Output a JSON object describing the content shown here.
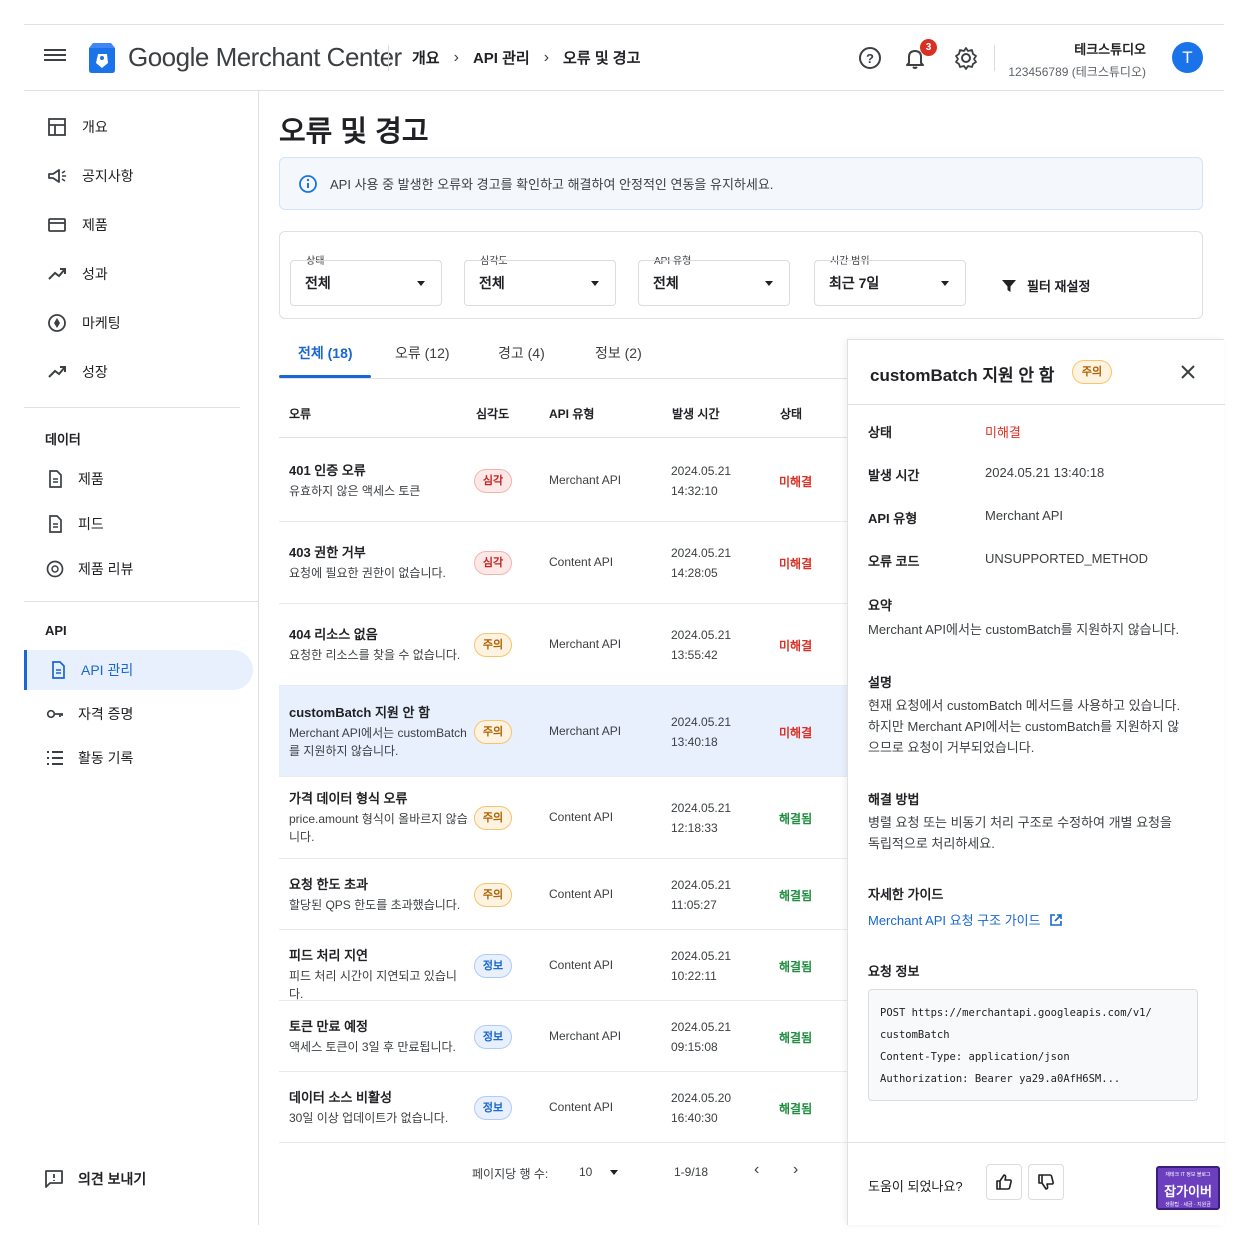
{
  "app": {
    "brand_google": "Google",
    "brand_product": " Merchant Center",
    "breadcrumbs": [
      "개요",
      "API 관리",
      "오류 및 경고"
    ],
    "notification_count": "3",
    "account_name": "테크스튜디오",
    "account_id": "123456789 (테크스튜디오)",
    "avatar_initial": "T"
  },
  "sidebar": {
    "items": [
      {
        "label": "개요",
        "icon": "dashboard-icon"
      },
      {
        "label": "공지사항",
        "icon": "megaphone-icon"
      },
      {
        "label": "제품",
        "icon": "store-icon"
      },
      {
        "label": "성과",
        "icon": "trending-icon"
      },
      {
        "label": "마케팅",
        "icon": "marketing-icon"
      },
      {
        "label": "성장",
        "icon": "growth-icon"
      }
    ],
    "data_header": "데이터",
    "data_items": [
      {
        "label": "제품",
        "icon": "document-icon"
      },
      {
        "label": "피드",
        "icon": "document-icon"
      },
      {
        "label": "제품 리뷰",
        "icon": "review-icon"
      }
    ],
    "api_header": "API",
    "api_items": [
      {
        "label": "API 관리",
        "icon": "document-icon",
        "active": true
      },
      {
        "label": "자격 증명",
        "icon": "key-icon"
      },
      {
        "label": "활동 기록",
        "icon": "list-icon"
      }
    ],
    "feedback_label": "의견 보내기"
  },
  "main": {
    "title": "오류 및 경고",
    "info_text": "API 사용 중 발생한 오류와 경고를 확인하고 해결하여 안정적인 연동을 유지하세요.",
    "filters": [
      {
        "label": "상태",
        "value": "전체"
      },
      {
        "label": "심각도",
        "value": "전체"
      },
      {
        "label": "API 유형",
        "value": "전체"
      },
      {
        "label": "시간 범위",
        "value": "최근 7일"
      }
    ],
    "reset_label": "필터 재설정",
    "tabs": [
      "전체 (18)",
      "오류 (12)",
      "경고 (4)",
      "정보 (2)"
    ],
    "columns": [
      "오류",
      "심각도",
      "API 유형",
      "발생 시간",
      "상태"
    ],
    "rows": [
      {
        "title": "401 인증 오류",
        "desc": "유효하지 않은 액세스 토큰",
        "severity": "심각",
        "api": "Merchant API",
        "date": "2024.05.21",
        "time": "14:32:10",
        "status": "미해결"
      },
      {
        "title": "403 권한 거부",
        "desc": "요청에 필요한 권한이 없습니다.",
        "severity": "심각",
        "api": "Content API",
        "date": "2024.05.21",
        "time": "14:28:05",
        "status": "미해결"
      },
      {
        "title": "404 리소스 없음",
        "desc": "요청한 리소스를 찾을 수 없습니다.",
        "severity": "주의",
        "api": "Merchant API",
        "date": "2024.05.21",
        "time": "13:55:42",
        "status": "미해결"
      },
      {
        "title": "customBatch 지원 안 함",
        "desc": "Merchant API에서는 customBatch를 지원하지 않습니다.",
        "severity": "주의",
        "api": "Merchant API",
        "date": "2024.05.21",
        "time": "13:40:18",
        "status": "미해결"
      },
      {
        "title": "가격 데이터 형식 오류",
        "desc": "price.amount 형식이 올바르지 않습니다.",
        "severity": "주의",
        "api": "Content API",
        "date": "2024.05.21",
        "time": "12:18:33",
        "status": "해결됨"
      },
      {
        "title": "요청 한도 초과",
        "desc": "할당된 QPS 한도를 초과했습니다.",
        "severity": "주의",
        "api": "Content API",
        "date": "2024.05.21",
        "time": "11:05:27",
        "status": "해결됨"
      },
      {
        "title": "피드 처리 지연",
        "desc": "피드 처리 시간이 지연되고 있습니다.",
        "severity": "정보",
        "api": "Content API",
        "date": "2024.05.21",
        "time": "10:22:11",
        "status": "해결됨"
      },
      {
        "title": "토큰 만료 예정",
        "desc": "액세스 토큰이 3일 후 만료됩니다.",
        "severity": "정보",
        "api": "Merchant API",
        "date": "2024.05.21",
        "time": "09:15:08",
        "status": "해결됨"
      },
      {
        "title": "데이터 소스 비활성",
        "desc": "30일 이상 업데이트가 없습니다.",
        "severity": "정보",
        "api": "Content API",
        "date": "2024.05.20",
        "time": "16:40:30",
        "status": "해결됨"
      }
    ],
    "pager": {
      "rows_label": "페이지당 행 수:",
      "rows_value": "10",
      "range": "1-9/18"
    }
  },
  "detail": {
    "title": "customBatch 지원 안 함",
    "severity": "주의",
    "fields": [
      {
        "key": "상태",
        "value": "미해결"
      },
      {
        "key": "발생 시간",
        "value": "2024.05.21 13:40:18"
      },
      {
        "key": "API 유형",
        "value": "Merchant API"
      },
      {
        "key": "오류 코드",
        "value": "UNSUPPORTED_METHOD"
      }
    ],
    "summary_h": "요약",
    "summary": "Merchant API에서는 customBatch를 지원하지 않습니다.",
    "desc_h": "설명",
    "desc": "현재 요청에서 customBatch 메서드를 사용하고 있습니다. 하지만 Merchant API에서는 customBatch를 지원하지 않으므로 요청이 거부되었습니다.",
    "fix_h": "해결 방법",
    "fix": "병렬 요청 또는 비동기 처리 구조로 수정하여 개별 요청을 독립적으로 처리하세요.",
    "guide_h": "자세한 가이드",
    "guide_link": "Merchant API 요청 구조 가이드",
    "request_h": "요청 정보",
    "code": [
      "POST https://merchantapi.googleapis.com/v1/",
      "customBatch",
      "Content-Type: application/json",
      "Authorization: Bearer ya29.a0AfH6SM..."
    ],
    "helpful": "도움이 되었나요?"
  },
  "watermark": {
    "top": "재테크 IT 정보 블로그",
    "mid": "잡가이버",
    "bot": "생활팁 · 세금 · 지원금"
  },
  "colors": {
    "accent": "#1967d2",
    "critical": "#c5221f",
    "warning": "#b06000",
    "resolved": "#1e8e3e",
    "unresolved": "#d93025"
  }
}
